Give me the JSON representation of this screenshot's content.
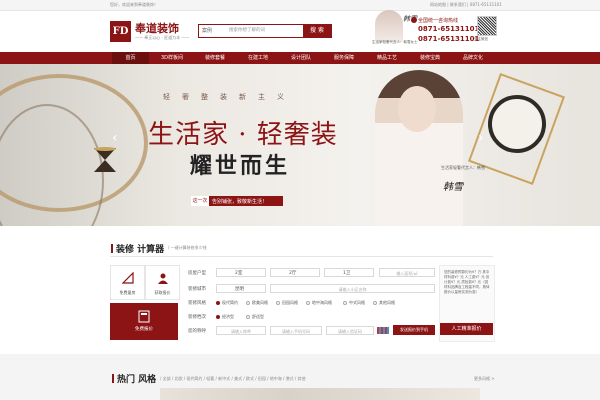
{
  "topbar": {
    "welcome": "您好，欢迎来到奉道装饰！",
    "links": "网站地图 | 联系我们 | 0871-65131101"
  },
  "header": {
    "logo_mark": "FD",
    "brand_name": "奉道装饰",
    "brand_slogan": "—— 奉正以心 · 匠道为本 ——",
    "search": {
      "scope": "案例",
      "placeholder": "搜索你想了解的词",
      "button": "搜 索"
    },
    "endorser_signature": "韩雪",
    "endorser_caption": "生活家轻奢代言人：韩雪女士",
    "hotline_label": "全国统一咨询热线",
    "phones": [
      "0871-65131101",
      "0871-65131101"
    ],
    "qr_label": "关注微信"
  },
  "nav": {
    "items": [
      "首页",
      "3D样板间",
      "装修套餐",
      "在建工地",
      "设计团队",
      "服务保障",
      "精品工艺",
      "装修宝典",
      "品牌文化"
    ],
    "active_index": 0
  },
  "banner": {
    "tagline": "轻奢整装新主义",
    "slogan_main": "生活家 · 轻奢装",
    "slogan_sub": "耀世而生",
    "strip_word": "这一次",
    "strip_text": "告别铺张，致敬新生活！",
    "signature": "韩雪",
    "caption": "生活家轻奢代言人：韩雪",
    "prev_arrow": "‹",
    "next_arrow": "›",
    "slide_count": 5,
    "active_slide": 0
  },
  "calculator": {
    "title": "装修 计算器",
    "subtitle": "/ 一键计算装修多少钱",
    "tiles": [
      {
        "label": "免费量房",
        "icon": "ruler-icon"
      },
      {
        "label": "获取报价",
        "icon": "person-icon"
      }
    ],
    "quote_tile": {
      "label": "免费报价",
      "icon": "calculator-icon"
    },
    "house_type_label": "房屋户型",
    "house_type_values": [
      "2室",
      "2厅",
      "1卫"
    ],
    "area_placeholder": "输入面积/㎡",
    "city_label": "装修城市",
    "city_value": "昆明",
    "community_placeholder": "请输入小区名称",
    "style_label": "装修风格",
    "styles": [
      "现代简约",
      "欧美风格",
      "田园风格",
      "地中海风格",
      "中式风格",
      "其他风格"
    ],
    "style_selected": 0,
    "grade_label": "装修档次",
    "grades": [
      "经济型",
      "舒适型"
    ],
    "grade_selected": 0,
    "contact_label": "您的称呼",
    "name_placeholder": "请输入称呼",
    "phone_placeholder": "请输入手机号码",
    "code_placeholder": "请输入验证码",
    "send_button": "发送报价到手机",
    "result_text": "您的装修预算约为¥？万 其中材料费¥？元 人工费¥？元 设计费¥？元 质检费¥？元（因材料品牌及工程量不同，具体报价以量房实测为准）",
    "quote_button": "人工精准报价"
  },
  "hot": {
    "title": "热门 风格",
    "filter": "/ 全部 / 北欧 / 现代简约 / 轻奢 / 新中式 / 美式 / 欧式 / 田园 / 地中海 / 港式 / 其他",
    "more": "更多风格 >"
  }
}
